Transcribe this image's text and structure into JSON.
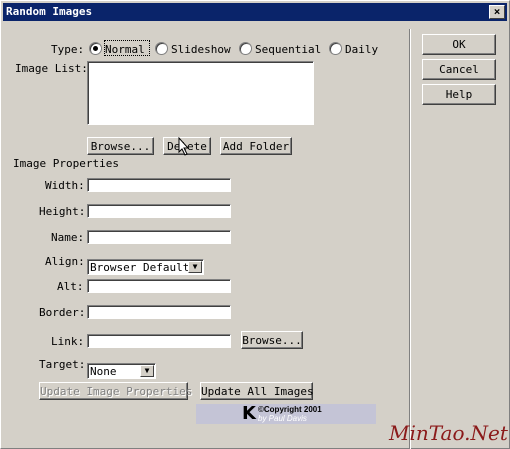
{
  "window": {
    "title": "Random Images",
    "close_glyph": "×"
  },
  "type": {
    "label": "Type:",
    "options": [
      "Normal",
      "Slideshow",
      "Sequential",
      "Daily"
    ],
    "selected": "Normal"
  },
  "image_list": {
    "label": "Image List:",
    "browse_label": "Browse...",
    "delete_label": "Delete",
    "add_folder_label": "Add Folder"
  },
  "properties": {
    "heading": "Image Properties",
    "width_label": "Width:",
    "height_label": "Height:",
    "name_label": "Name:",
    "align_label": "Align:",
    "align_value": "Browser Default",
    "alt_label": "Alt:",
    "border_label": "Border:",
    "link_label": "Link:",
    "link_browse_label": "Browse...",
    "target_label": "Target:",
    "target_value": "None",
    "update_image_label": "Update Image Properties",
    "update_all_label": "Update All Images"
  },
  "dialog_buttons": {
    "ok": "OK",
    "cancel": "Cancel",
    "help": "Help"
  },
  "logo": {
    "letter": "K",
    "copyright": "©Copyright 2001",
    "author": "by Paul Davis"
  },
  "watermark": "MinTao.Net",
  "icons": {
    "cursor": "mouse-pointer-icon",
    "dropdown": "chevron-down-icon",
    "close": "close-icon"
  },
  "colors": {
    "titlebar": "#0a246a",
    "face": "#d4d0c8",
    "watermark": "#8b1a1a"
  }
}
